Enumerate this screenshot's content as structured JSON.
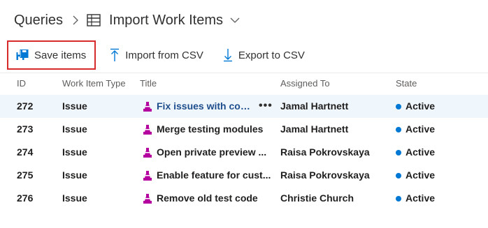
{
  "breadcrumb": {
    "root": "Queries",
    "current": "Import Work Items"
  },
  "toolbar": {
    "save_label": "Save items",
    "import_label": "Import from CSV",
    "export_label": "Export to CSV"
  },
  "grid": {
    "columns": {
      "id": "ID",
      "type": "Work Item Type",
      "title": "Title",
      "assigned": "Assigned To",
      "state": "State"
    },
    "rows": [
      {
        "id": "272",
        "type": "Issue",
        "title": "Fix issues with code",
        "assigned": "Jamal Hartnett",
        "state": "Active"
      },
      {
        "id": "273",
        "type": "Issue",
        "title": "Merge testing modules",
        "assigned": "Jamal Hartnett",
        "state": "Active"
      },
      {
        "id": "274",
        "type": "Issue",
        "title": "Open private preview ...",
        "assigned": "Raisa Pokrovskaya",
        "state": "Active"
      },
      {
        "id": "275",
        "type": "Issue",
        "title": "Enable feature for cust...",
        "assigned": "Raisa Pokrovskaya",
        "state": "Active"
      },
      {
        "id": "276",
        "type": "Issue",
        "title": "Remove old test code",
        "assigned": "Christie Church",
        "state": "Active"
      }
    ],
    "more_actions": "•••"
  },
  "colors": {
    "accent": "#0078d4",
    "issue_icon": "#b4009e",
    "selected_row": "#eff6fc",
    "highlight_box": "#d82a2a"
  },
  "icons": {
    "table": "table-icon",
    "save": "save-items-icon",
    "import": "upload-arrow-icon",
    "export": "download-arrow-icon",
    "issue": "issue-icon"
  }
}
